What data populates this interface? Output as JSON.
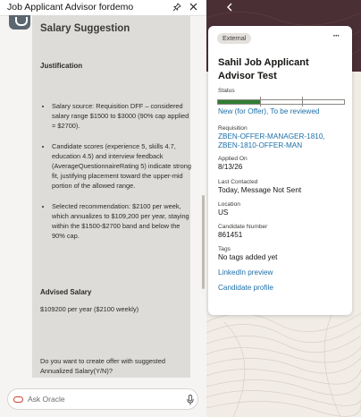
{
  "window": {
    "title": "Job Applicant Advisor fordemo"
  },
  "chat": {
    "heading": "Salary Suggestion",
    "justification_heading": "Justification",
    "justification_points": [
      "Salary source: Requisition DFF – considered salary range $1500 to $3000 (90% cap applied = $2700).",
      "Candidate scores (experience 5, skills 4.7, education 4.5) and interview feedback (AverageQuestionnaireRating 5) indicate strong fit, justifying placement toward the upper-mid portion of the allowed range.",
      "Selected recommendation: $2100 per week, which annualizes to $109,200 per year, staying within the $1500-$2700 band and below the 90% cap."
    ],
    "advised_heading": "Advised Salary",
    "advised_value": "$109200 per year ($2100 weekly)",
    "question": "Do you want to create offer with suggested Annualized Salary(Y/N)?",
    "input_placeholder": "Ask Oracle"
  },
  "candidate": {
    "badge": "External",
    "name": "Sahil Job Applicant Advisor Test",
    "status_label": "Status",
    "status_progress": 0.34,
    "status_value": "New (for Offer), To be reviewed",
    "requisition_label": "Requisition",
    "requisition_value": "ZBEN-OFFER-MANAGER-1810, ZBEN-1810-OFFER-MAN",
    "applied_label": "Applied On",
    "applied_value": "8/13/26",
    "contacted_label": "Last Contacted",
    "contacted_value": "Today, Message Not Sent",
    "location_label": "Location",
    "location_value": "US",
    "number_label": "Candidate Number",
    "number_value": "861451",
    "tags_label": "Tags",
    "tags_value": "No tags added yet",
    "linkedin_link": "LinkedIn preview",
    "profile_link": "Candidate profile"
  },
  "colors": {
    "oracle_red": "#c74634",
    "link_blue": "#1e6fa8",
    "progress_green": "#2f7d32",
    "header_band": "#4a2f35"
  },
  "icons": {
    "back": "chevron-left-icon",
    "pin": "pin-icon",
    "close": "close-icon",
    "more": "ellipsis-icon",
    "mic": "microphone-icon",
    "brand": "oracle-logo-icon"
  }
}
